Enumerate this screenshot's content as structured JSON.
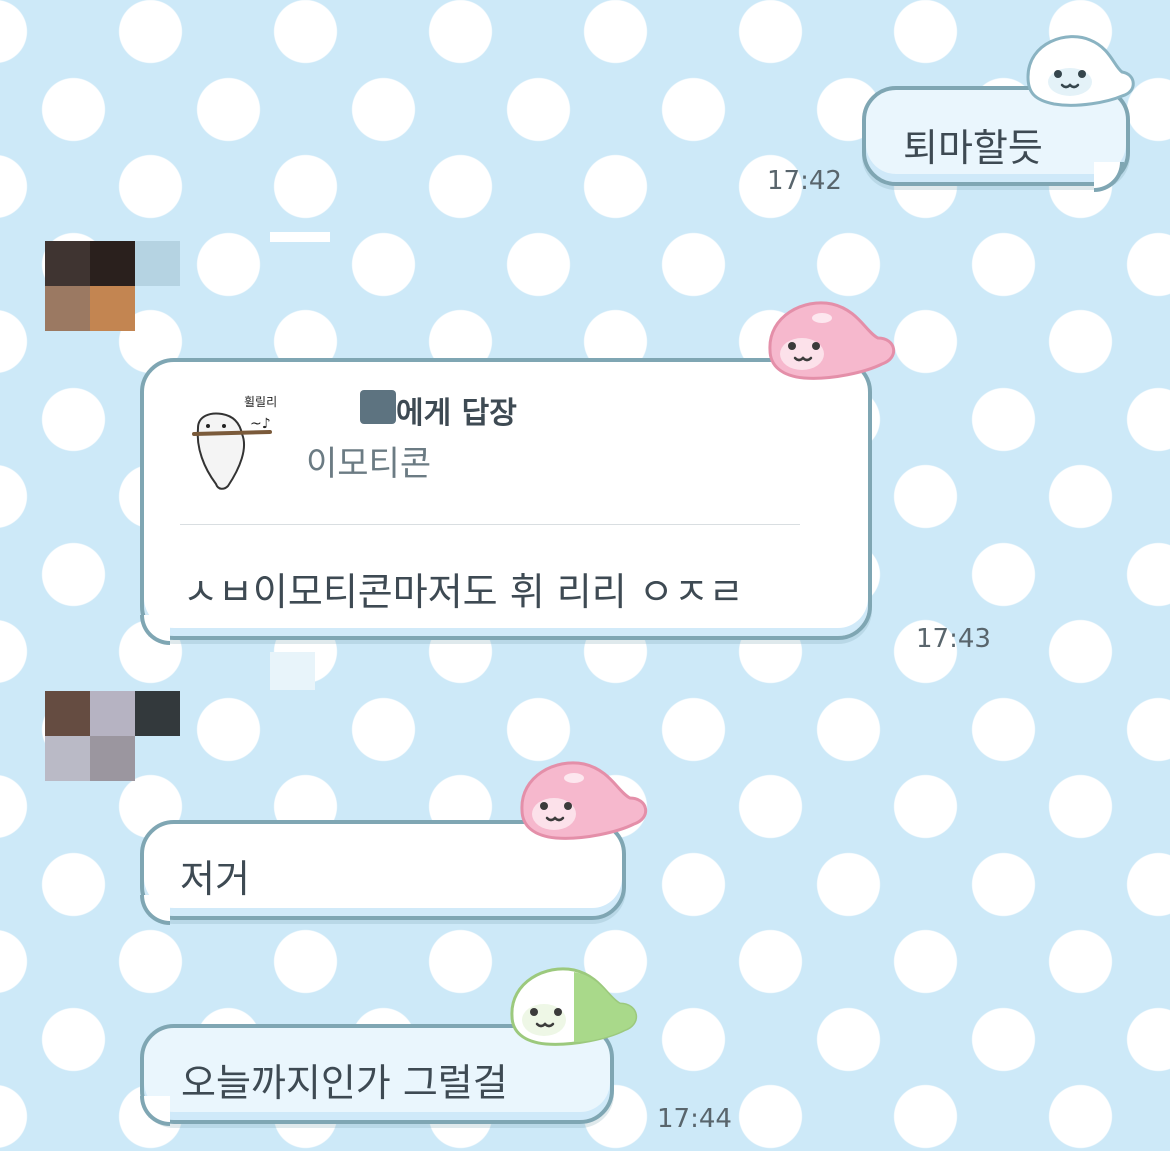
{
  "messages": {
    "m1": {
      "text": "퇴마할듯",
      "time": "17:42"
    },
    "m2": {
      "reply_target": "에게 답장",
      "reply_preview": "이모티콘",
      "emoticon_caption": "휠릴리",
      "emoticon_note": "~♪",
      "text": "ㅅㅂ이모티콘마저도 휘 리리 ㅇㅈㄹ",
      "time": "17:43"
    },
    "m3": {
      "text": "저거"
    },
    "m4": {
      "text": "오늘까지인가 그럴걸",
      "time": "17:44"
    }
  },
  "colors": {
    "background": "#cde9f8",
    "bubble_border": "#7fa6b3",
    "text": "#3e4a53",
    "mascot_white": "#ffffff",
    "mascot_pink": "#f6b8cd",
    "mascot_green": "#a9d98a"
  },
  "icons": {
    "mascot_1": "white-seal-mascot-icon",
    "mascot_2": "pink-seal-mascot-icon",
    "mascot_3": "pink-seal-mascot-icon",
    "mascot_4": "green-seal-mascot-icon",
    "emoticon": "seal-whistle-emoticon"
  }
}
